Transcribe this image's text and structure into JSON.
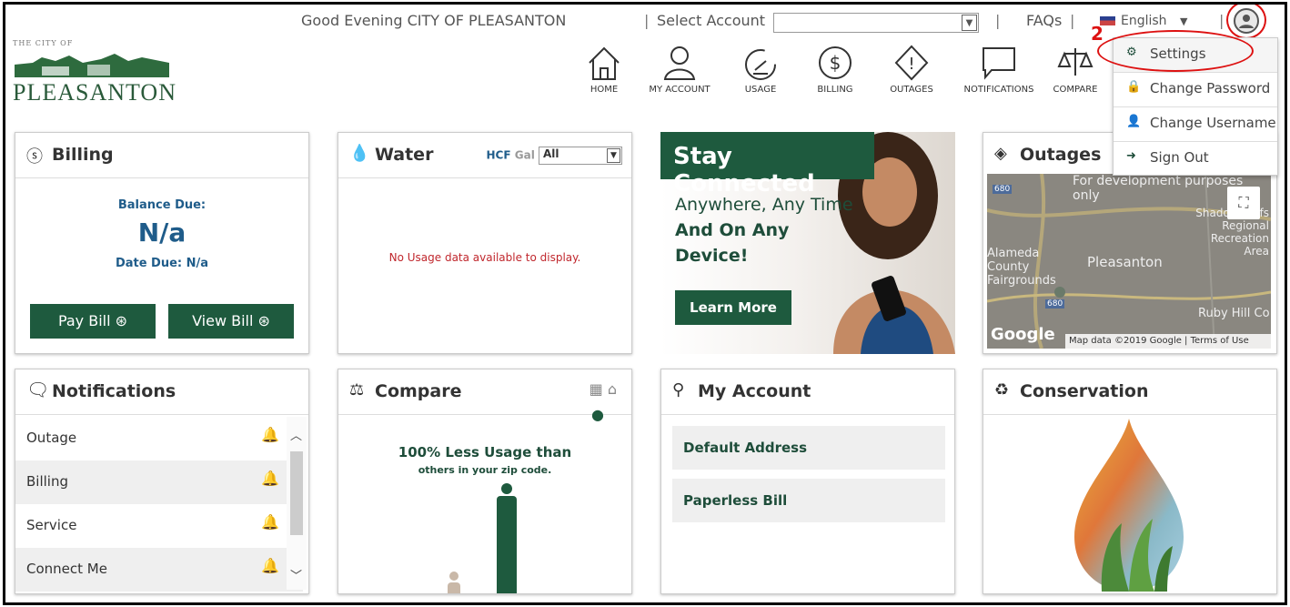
{
  "topbar": {
    "greeting": "Good Evening CITY OF PLEASANTON",
    "select_account_label": "Select Account",
    "select_account_value": "",
    "faqs": "FAQs",
    "language": "English",
    "step_marker": "2",
    "separator": "|"
  },
  "logo": {
    "small": "THE CITY OF",
    "name": "PLEASANTON"
  },
  "nav": [
    {
      "label": "HOME",
      "icon": "home-icon"
    },
    {
      "label": "MY ACCOUNT",
      "icon": "user-icon"
    },
    {
      "label": "USAGE",
      "icon": "gauge-icon"
    },
    {
      "label": "BILLING",
      "icon": "dollar-icon"
    },
    {
      "label": "OUTAGES",
      "icon": "alert-icon"
    },
    {
      "label": "NOTIFICATIONS",
      "icon": "speech-bubble-icon"
    },
    {
      "label": "COMPARE",
      "icon": "scale-icon"
    }
  ],
  "user_menu": [
    {
      "label": "Settings",
      "icon": "gear-icon"
    },
    {
      "label": "Change Password",
      "icon": "lock-icon"
    },
    {
      "label": "Change Username",
      "icon": "user-icon"
    },
    {
      "label": "Sign Out",
      "icon": "sign-out-icon"
    }
  ],
  "billing": {
    "title": "Billing",
    "balance_label": "Balance Due:",
    "balance_value": "N/a",
    "date_due": "Date Due: N/a",
    "pay_bill": "Pay Bill",
    "view_bill": "View Bill"
  },
  "water": {
    "title": "Water",
    "unit_hcf": "HCF",
    "unit_gal": "Gal",
    "filter_value": "All",
    "empty_message": "No Usage data available to display."
  },
  "promo": {
    "banner": "Stay Connected",
    "line1": "Anywhere, Any Time",
    "line2": "And On Any",
    "line3": "Device!",
    "button": "Learn More"
  },
  "outages": {
    "title": "Outages",
    "map_text_top": "For development purposes only",
    "map_labels": [
      "Shadow Cliffs Regional Recreation Area",
      "Alameda County Fairgrounds",
      "Pleasanton",
      "Ruby Hill Co",
      "680",
      "680"
    ],
    "map_attribution": "Map data ©2019 Google | Terms of Use",
    "google": "Google"
  },
  "notifications": {
    "title": "Notifications",
    "items": [
      "Outage",
      "Billing",
      "Service",
      "Connect Me"
    ]
  },
  "compare": {
    "title": "Compare",
    "headline": "100% Less Usage than",
    "subline": "others in your zip code."
  },
  "my_account": {
    "title": "My Account",
    "fields": [
      "Default Address",
      "Paperless Bill"
    ]
  },
  "conservation": {
    "title": "Conservation"
  },
  "colors": {
    "brand_green": "#1e5a3e",
    "link_blue": "#1f5c8a",
    "annotation_red": "#dd1111",
    "error_red": "#c0272d"
  }
}
